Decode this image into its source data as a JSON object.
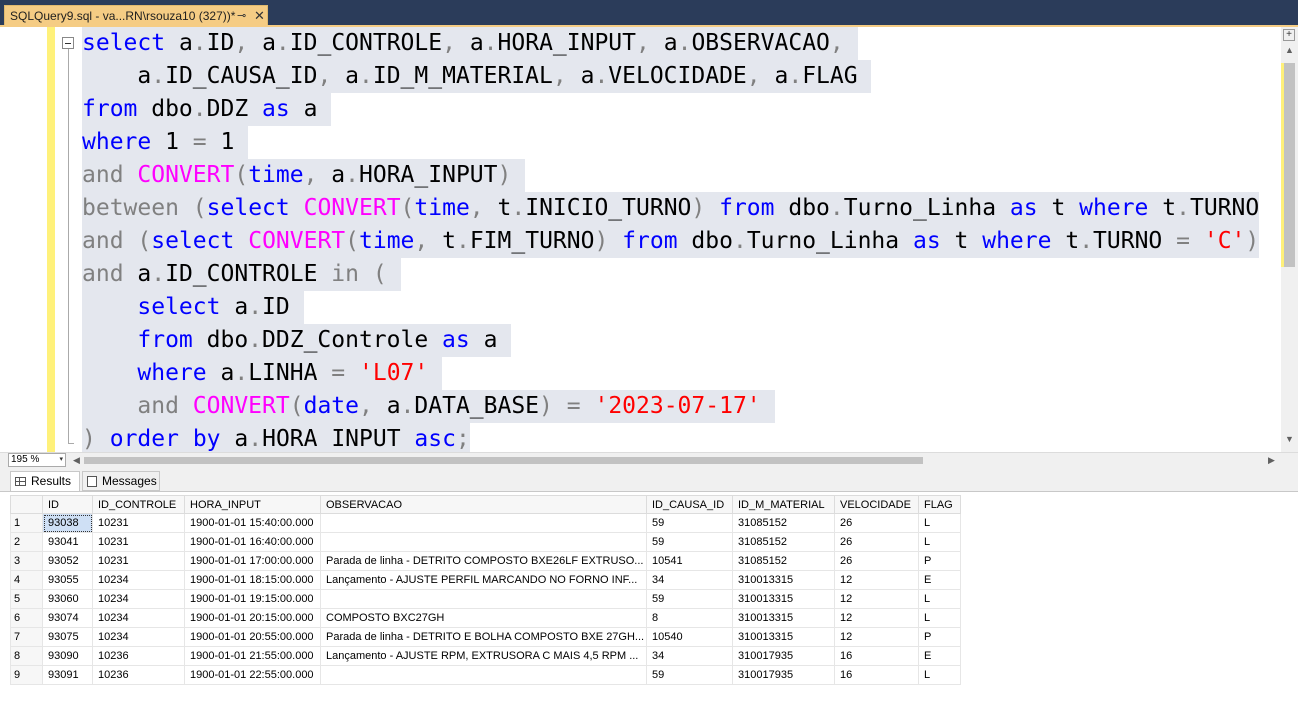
{
  "tab": {
    "title": "SQLQuery9.sql - va...RN\\rsouza10 (327))*",
    "pin": "⊸",
    "close": "✕"
  },
  "code_lines": [
    [
      {
        "t": "select",
        "c": "kw"
      },
      {
        "t": " a"
      },
      {
        "t": ".",
        "c": "gr"
      },
      {
        "t": "ID"
      },
      {
        "t": ",",
        "c": "gr"
      },
      {
        "t": " a"
      },
      {
        "t": ".",
        "c": "gr"
      },
      {
        "t": "ID_CONTROLE"
      },
      {
        "t": ",",
        "c": "gr"
      },
      {
        "t": " a"
      },
      {
        "t": ".",
        "c": "gr"
      },
      {
        "t": "HORA_INPUT"
      },
      {
        "t": ",",
        "c": "gr"
      },
      {
        "t": " a"
      },
      {
        "t": ".",
        "c": "gr"
      },
      {
        "t": "OBSERVACAO"
      },
      {
        "t": ",",
        "c": "gr"
      },
      {
        "t": " "
      }
    ],
    [
      {
        "t": "    a"
      },
      {
        "t": ".",
        "c": "gr"
      },
      {
        "t": "ID_CAUSA_ID"
      },
      {
        "t": ",",
        "c": "gr"
      },
      {
        "t": " a"
      },
      {
        "t": ".",
        "c": "gr"
      },
      {
        "t": "ID_M_MATERIAL"
      },
      {
        "t": ",",
        "c": "gr"
      },
      {
        "t": " a"
      },
      {
        "t": ".",
        "c": "gr"
      },
      {
        "t": "VELOCIDADE"
      },
      {
        "t": ",",
        "c": "gr"
      },
      {
        "t": " a"
      },
      {
        "t": ".",
        "c": "gr"
      },
      {
        "t": "FLAG "
      }
    ],
    [
      {
        "t": "from",
        "c": "kw"
      },
      {
        "t": " dbo"
      },
      {
        "t": ".",
        "c": "gr"
      },
      {
        "t": "DDZ "
      },
      {
        "t": "as",
        "c": "kw"
      },
      {
        "t": " a "
      }
    ],
    [
      {
        "t": "where",
        "c": "kw"
      },
      {
        "t": " 1 "
      },
      {
        "t": "=",
        "c": "gr"
      },
      {
        "t": " 1 "
      }
    ],
    [
      {
        "t": "and",
        "c": "gr"
      },
      {
        "t": " "
      },
      {
        "t": "CONVERT",
        "c": "fn"
      },
      {
        "t": "(",
        "c": "gr"
      },
      {
        "t": "time",
        "c": "kw"
      },
      {
        "t": ",",
        "c": "gr"
      },
      {
        "t": " a"
      },
      {
        "t": ".",
        "c": "gr"
      },
      {
        "t": "HORA_INPUT"
      },
      {
        "t": ")",
        "c": "gr"
      },
      {
        "t": " "
      }
    ],
    [
      {
        "t": "between",
        "c": "gr"
      },
      {
        "t": " "
      },
      {
        "t": "(",
        "c": "gr"
      },
      {
        "t": "select",
        "c": "kw"
      },
      {
        "t": " "
      },
      {
        "t": "CONVERT",
        "c": "fn"
      },
      {
        "t": "(",
        "c": "gr"
      },
      {
        "t": "time",
        "c": "kw"
      },
      {
        "t": ",",
        "c": "gr"
      },
      {
        "t": " t"
      },
      {
        "t": ".",
        "c": "gr"
      },
      {
        "t": "INICIO_TURNO"
      },
      {
        "t": ")",
        "c": "gr"
      },
      {
        "t": " "
      },
      {
        "t": "from",
        "c": "kw"
      },
      {
        "t": " dbo"
      },
      {
        "t": ".",
        "c": "gr"
      },
      {
        "t": "Turno_Linha "
      },
      {
        "t": "as",
        "c": "kw"
      },
      {
        "t": " t "
      },
      {
        "t": "where",
        "c": "kw"
      },
      {
        "t": " t"
      },
      {
        "t": ".",
        "c": "gr"
      },
      {
        "t": "TURNO"
      }
    ],
    [
      {
        "t": "and",
        "c": "gr"
      },
      {
        "t": " "
      },
      {
        "t": "(",
        "c": "gr"
      },
      {
        "t": "select",
        "c": "kw"
      },
      {
        "t": " "
      },
      {
        "t": "CONVERT",
        "c": "fn"
      },
      {
        "t": "(",
        "c": "gr"
      },
      {
        "t": "time",
        "c": "kw"
      },
      {
        "t": ",",
        "c": "gr"
      },
      {
        "t": " t"
      },
      {
        "t": ".",
        "c": "gr"
      },
      {
        "t": "FIM_TURNO"
      },
      {
        "t": ")",
        "c": "gr"
      },
      {
        "t": " "
      },
      {
        "t": "from",
        "c": "kw"
      },
      {
        "t": " dbo"
      },
      {
        "t": ".",
        "c": "gr"
      },
      {
        "t": "Turno_Linha "
      },
      {
        "t": "as",
        "c": "kw"
      },
      {
        "t": " t "
      },
      {
        "t": "where",
        "c": "kw"
      },
      {
        "t": " t"
      },
      {
        "t": ".",
        "c": "gr"
      },
      {
        "t": "TURNO "
      },
      {
        "t": "=",
        "c": "gr"
      },
      {
        "t": " "
      },
      {
        "t": "'C'",
        "c": "str"
      },
      {
        "t": ")",
        "c": "gr"
      }
    ],
    [
      {
        "t": "and",
        "c": "gr"
      },
      {
        "t": " a"
      },
      {
        "t": ".",
        "c": "gr"
      },
      {
        "t": "ID_CONTROLE "
      },
      {
        "t": "in",
        "c": "gr"
      },
      {
        "t": " "
      },
      {
        "t": "(",
        "c": "gr"
      },
      {
        "t": " "
      }
    ],
    [
      {
        "t": "    "
      },
      {
        "t": "select",
        "c": "kw"
      },
      {
        "t": " a"
      },
      {
        "t": ".",
        "c": "gr"
      },
      {
        "t": "ID "
      }
    ],
    [
      {
        "t": "    "
      },
      {
        "t": "from",
        "c": "kw"
      },
      {
        "t": " dbo"
      },
      {
        "t": ".",
        "c": "gr"
      },
      {
        "t": "DDZ_Controle "
      },
      {
        "t": "as",
        "c": "kw"
      },
      {
        "t": " a "
      }
    ],
    [
      {
        "t": "    "
      },
      {
        "t": "where",
        "c": "kw"
      },
      {
        "t": " a"
      },
      {
        "t": ".",
        "c": "gr"
      },
      {
        "t": "LINHA "
      },
      {
        "t": "=",
        "c": "gr"
      },
      {
        "t": " "
      },
      {
        "t": "'L07'",
        "c": "str"
      },
      {
        "t": " "
      }
    ],
    [
      {
        "t": "    "
      },
      {
        "t": "and",
        "c": "gr"
      },
      {
        "t": " "
      },
      {
        "t": "CONVERT",
        "c": "fn"
      },
      {
        "t": "(",
        "c": "gr"
      },
      {
        "t": "date",
        "c": "kw"
      },
      {
        "t": ",",
        "c": "gr"
      },
      {
        "t": " a"
      },
      {
        "t": ".",
        "c": "gr"
      },
      {
        "t": "DATA_BASE"
      },
      {
        "t": ")",
        "c": "gr"
      },
      {
        "t": " "
      },
      {
        "t": "=",
        "c": "gr"
      },
      {
        "t": " "
      },
      {
        "t": "'2023-07-17'",
        "c": "str"
      },
      {
        "t": " "
      }
    ],
    [
      {
        "t": ")",
        "c": "gr"
      },
      {
        "t": " "
      },
      {
        "t": "order",
        "c": "kw"
      },
      {
        "t": " "
      },
      {
        "t": "by",
        "c": "kw"
      },
      {
        "t": " a"
      },
      {
        "t": ".",
        "c": "gr"
      },
      {
        "t": "HORA INPUT "
      },
      {
        "t": "asc",
        "c": "kw"
      },
      {
        "t": ";",
        "c": "gr"
      }
    ]
  ],
  "zoom": {
    "value": "195 %",
    "dropdown": "▾"
  },
  "results_tabs": {
    "results": "Results",
    "messages": "Messages"
  },
  "columns": [
    "",
    "ID",
    "ID_CONTROLE",
    "HORA_INPUT",
    "OBSERVACAO",
    "ID_CAUSA_ID",
    "ID_M_MATERIAL",
    "VELOCIDADE",
    "FLAG"
  ],
  "rows": [
    [
      "1",
      "93038",
      "10231",
      "1900-01-01 15:40:00.000",
      "",
      "59",
      "31085152",
      "26",
      "L"
    ],
    [
      "2",
      "93041",
      "10231",
      "1900-01-01 16:40:00.000",
      "",
      "59",
      "31085152",
      "26",
      "L"
    ],
    [
      "3",
      "93052",
      "10231",
      "1900-01-01 17:00:00.000",
      "Parada de linha - DETRITO COMPOSTO BXE26LF EXTRUSO...",
      "10541",
      "31085152",
      "26",
      "P"
    ],
    [
      "4",
      "93055",
      "10234",
      "1900-01-01 18:15:00.000",
      "Lançamento - AJUSTE PERFIL MARCANDO NO FORNO INF...",
      "34",
      "310013315",
      "12",
      "E"
    ],
    [
      "5",
      "93060",
      "10234",
      "1900-01-01 19:15:00.000",
      "",
      "59",
      "310013315",
      "12",
      "L"
    ],
    [
      "6",
      "93074",
      "10234",
      "1900-01-01 20:15:00.000",
      "COMPOSTO BXC27GH",
      "8",
      "310013315",
      "12",
      "L"
    ],
    [
      "7",
      "93075",
      "10234",
      "1900-01-01 20:55:00.000",
      "Parada de linha - DETRITO E BOLHA COMPOSTO BXE 27GH...",
      "10540",
      "310013315",
      "12",
      "P"
    ],
    [
      "8",
      "93090",
      "10236",
      "1900-01-01 21:55:00.000",
      "Lançamento - AJUSTE RPM, EXTRUSORA C MAIS 4,5 RPM ...",
      "34",
      "310017935",
      "16",
      "E"
    ],
    [
      "9",
      "93091",
      "10236",
      "1900-01-01 22:55:00.000",
      "",
      "59",
      "310017935",
      "16",
      "L"
    ]
  ]
}
